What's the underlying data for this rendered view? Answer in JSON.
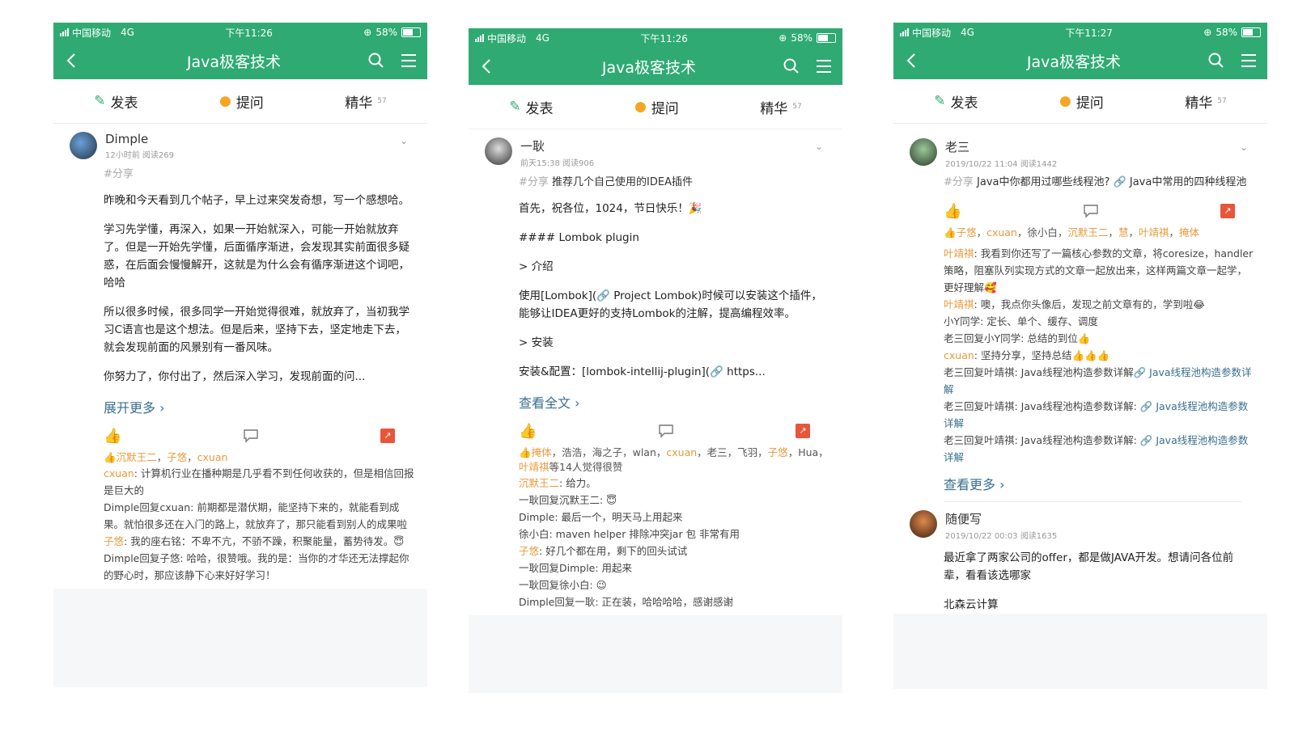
{
  "phones": [
    {
      "status": {
        "carrier": "中国移动",
        "network": "4G",
        "time": "下午11:26",
        "battery": "58%",
        "battery_level": 0.58
      },
      "nav": {
        "title": "Java极客技术"
      },
      "tabs": {
        "post": "发表",
        "ask": "提问",
        "featured": "精华",
        "featured_count": "57"
      },
      "post": {
        "author": "Dimple",
        "meta": "12小时前   阅读269",
        "tag": "#分享",
        "paragraphs": [
          "昨晚和今天看到几个帖子，早上过来突发奇想，写一个感想哈。",
          "学习先学懂，再深入，如果一开始就深入，可能一开始就放弃了。但是一开始先学懂，后面循序渐进，会发现其实前面很多疑惑，在后面会慢慢解开，这就是为什么会有循序渐进这个词吧，哈哈",
          "所以很多时候，很多同学一开始觉得很难，就放弃了，当初我学习C语言也是这个想法。但是后来，坚持下去，坚定地走下去，就会发现前面的风景别有一番风味。",
          "你努力了，你付出了，然后深入学习，发现前面的问..."
        ],
        "more": "展开更多 ›",
        "likes": [
          {
            "text": "沉默王二",
            "hl": true
          },
          {
            "text": "，",
            "hl": false
          },
          {
            "text": "子悠",
            "hl": true
          },
          {
            "text": "，",
            "hl": false
          },
          {
            "text": "cxuan",
            "hl": true
          }
        ],
        "comments": [
          [
            {
              "t": "cxuan",
              "c": "n"
            },
            {
              "t": ": 计算机行业在播种期是几乎看不到任何收获的，但是相信回报是巨大的",
              "c": ""
            }
          ],
          [
            {
              "t": "Dimple回复cxuan: 前期都是潜伏期，能坚持下来的，就能看到成果。就怕很多还在入门的路上，就放弃了，那只能看到别人的成果啦",
              "c": ""
            }
          ],
          [
            {
              "t": "子悠",
              "c": "n"
            },
            {
              "t": ": 我的座右铭：不卑不亢，不骄不躁，积聚能量，蓄势待发。😇",
              "c": ""
            }
          ],
          [
            {
              "t": "Dimple回复子悠: 哈哈，很赞哦。我的是：当你的才华还无法撑起你的野心时，那应该静下心来好好学习！",
              "c": ""
            }
          ]
        ]
      }
    },
    {
      "status": {
        "carrier": "中国移动",
        "network": "4G",
        "time": "下午11:26",
        "battery": "58%",
        "battery_level": 0.58
      },
      "nav": {
        "title": "Java极客技术"
      },
      "tabs": {
        "post": "发表",
        "ask": "提问",
        "featured": "精华",
        "featured_count": "57"
      },
      "post": {
        "author": "一耿",
        "meta": "前天15:38   阅读906",
        "tag": "#分享",
        "title": "推荐几个自己使用的IDEA插件",
        "paragraphs": [
          "首先，祝各位，1024，节日快乐！🎉",
          "#### Lombok plugin",
          "> 介绍",
          "使用[Lombok](🔗 Project Lombok)时候可以安装这个插件，能够让IDEA更好的支持Lombok的注解，提高编程效率。",
          "> 安装",
          "安装&配置：[lombok-intellij-plugin](🔗 https..."
        ],
        "more": "查看全文 ›",
        "likes": [
          {
            "text": "掩体",
            "hl": true
          },
          {
            "text": "，浩浩，海之子，wlan，",
            "hl": false
          },
          {
            "text": "cxuan",
            "hl": true
          },
          {
            "text": "，老三，飞羽，",
            "hl": false
          },
          {
            "text": "子悠",
            "hl": true
          },
          {
            "text": "，Hua，",
            "hl": false
          },
          {
            "text": "叶靖祺",
            "hl": true
          },
          {
            "text": "等14人觉得很赞",
            "hl": false
          }
        ],
        "comments": [
          [
            {
              "t": "沉默王二",
              "c": "n"
            },
            {
              "t": ": 给力。",
              "c": ""
            }
          ],
          [
            {
              "t": "一耿回复沉默王二: 😇",
              "c": ""
            }
          ],
          [
            {
              "t": "Dimple: 最后一个，明天马上用起来",
              "c": ""
            }
          ],
          [
            {
              "t": "徐小白: maven helper 排除冲突jar 包 非常有用",
              "c": ""
            }
          ],
          [
            {
              "t": "子悠",
              "c": "n"
            },
            {
              "t": ": 好几个都在用，剩下的回头试试",
              "c": ""
            }
          ],
          [
            {
              "t": "一耿回复Dimple: 用起来",
              "c": ""
            }
          ],
          [
            {
              "t": "一耿回复徐小白: 😉",
              "c": ""
            }
          ],
          [
            {
              "t": "Dimple回复一耿: 正在装，哈哈哈哈，感谢感谢",
              "c": ""
            }
          ]
        ]
      }
    },
    {
      "status": {
        "carrier": "中国移动",
        "network": "4G",
        "time": "下午11:27",
        "battery": "58%",
        "battery_level": 0.58
      },
      "nav": {
        "title": "Java极客技术"
      },
      "tabs": {
        "post": "发表",
        "ask": "提问",
        "featured": "精华",
        "featured_count": "57"
      },
      "post": {
        "author": "老三",
        "meta": "2019/10/22 11:04   阅读1442",
        "tag": "#分享",
        "title": "Java中你都用过哪些线程池? 🔗 Java中常用的四种线程池",
        "paragraphs": [],
        "more": "查看更多 ›",
        "likes": [
          {
            "text": "子悠",
            "hl": true
          },
          {
            "text": "，",
            "hl": false
          },
          {
            "text": "cxuan",
            "hl": true
          },
          {
            "text": "，徐小白，",
            "hl": false
          },
          {
            "text": "沉默王二",
            "hl": true
          },
          {
            "text": "，",
            "hl": false
          },
          {
            "text": "慧",
            "hl": true
          },
          {
            "text": "，",
            "hl": false
          },
          {
            "text": "叶靖祺",
            "hl": true
          },
          {
            "text": "，",
            "hl": false
          },
          {
            "text": "掩体",
            "hl": true
          }
        ],
        "comments": [
          [
            {
              "t": "叶靖祺",
              "c": "n"
            },
            {
              "t": ": 我看到你还写了一篇核心参数的文章，将coresize，handler 策略，阻塞队列实现方式的文章一起放出来，这样两篇文章一起学，更好理解🥰",
              "c": ""
            }
          ],
          [
            {
              "t": "叶靖祺",
              "c": "n"
            },
            {
              "t": ": 噢，我点你头像后，发现之前文章有的，学到啦😂",
              "c": ""
            }
          ],
          [
            {
              "t": "小Y同学: 定长、单个、缓存、调度",
              "c": ""
            }
          ],
          [
            {
              "t": "老三回复小Y同学: 总结的到位👍",
              "c": ""
            }
          ],
          [
            {
              "t": "cxuan",
              "c": "n"
            },
            {
              "t": ": 坚持分享，坚持总结👍👍👍",
              "c": ""
            }
          ],
          [
            {
              "t": "老三回复叶靖祺: Java线程池构造参数详解",
              "c": ""
            },
            {
              "t": "🔗 Java线程池构造参数详解",
              "c": "b"
            }
          ],
          [
            {
              "t": "老三回复叶靖祺: Java线程池构造参数详解: ",
              "c": ""
            },
            {
              "t": "🔗 Java线程池构造参数详解",
              "c": "b"
            }
          ],
          [
            {
              "t": "老三回复叶靖祺: Java线程池构造参数详解: ",
              "c": ""
            },
            {
              "t": "🔗 Java线程池构造参数详解",
              "c": "b"
            }
          ]
        ],
        "second_post": {
          "author": "随便写",
          "meta": "2019/10/22 00:03   阅读1635",
          "text": "最近拿了两家公司的offer，都是做JAVA开发。想请问各位前辈，看看该选哪家",
          "extra": "北森云计算"
        }
      }
    }
  ],
  "colors": {
    "accent": "#2faa73",
    "name_highlight": "#e69a3c",
    "link": "#3a6f8f"
  }
}
